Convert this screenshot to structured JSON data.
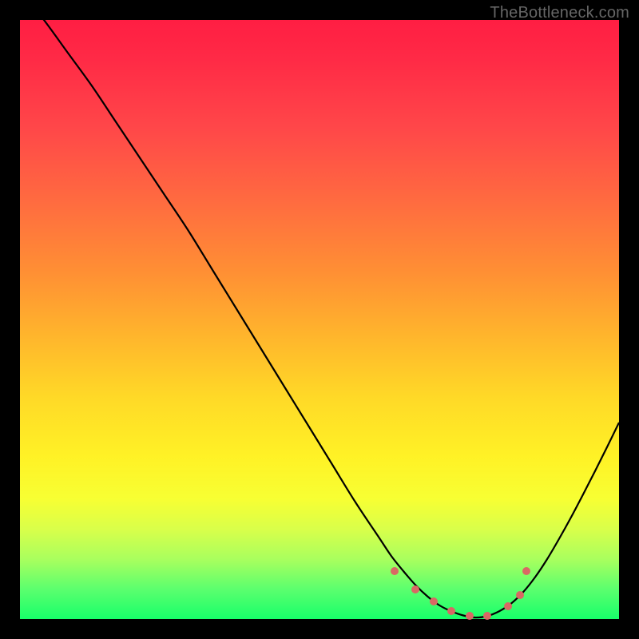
{
  "watermark": "TheBottleneck.com",
  "colors": {
    "curve": "#000000",
    "marker": "#d96864",
    "background": "#000000"
  },
  "chart_data": {
    "type": "line",
    "title": "",
    "xlabel": "",
    "ylabel": "",
    "xlim": [
      0,
      100
    ],
    "ylim": [
      0,
      100
    ],
    "grid": false,
    "series": [
      {
        "name": "bottleneck-curve",
        "x": [
          0,
          4,
          8,
          12,
          16,
          20,
          24,
          28,
          32,
          36,
          40,
          44,
          48,
          52,
          56,
          60,
          62,
          64,
          66,
          68,
          70,
          72,
          74,
          76,
          78,
          80,
          82,
          84,
          86,
          88,
          90,
          92,
          94,
          96,
          98,
          100
        ],
        "values": [
          105,
          100,
          94.5,
          89,
          83,
          77,
          71,
          65,
          58.5,
          52,
          45.5,
          39,
          32.5,
          26,
          19.5,
          13.5,
          10.5,
          8,
          5.7,
          3.8,
          2.3,
          1.3,
          0.6,
          0.25,
          0.5,
          1.3,
          2.6,
          4.5,
          7,
          10,
          13.4,
          17,
          20.8,
          24.7,
          28.7,
          32.8
        ]
      }
    ],
    "markers": [
      {
        "x": 62.5,
        "y": 8.0
      },
      {
        "x": 66.0,
        "y": 5.0
      },
      {
        "x": 69.0,
        "y": 3.0
      },
      {
        "x": 72.0,
        "y": 1.3
      },
      {
        "x": 75.0,
        "y": 0.5
      },
      {
        "x": 78.0,
        "y": 0.6
      },
      {
        "x": 81.5,
        "y": 2.2
      },
      {
        "x": 83.5,
        "y": 4.0
      },
      {
        "x": 84.5,
        "y": 8.0
      }
    ],
    "gradient_stops": [
      {
        "pos": 0,
        "color": "#ff1e43"
      },
      {
        "pos": 50,
        "color": "#ffc927"
      },
      {
        "pos": 80,
        "color": "#f0ff30"
      },
      {
        "pos": 100,
        "color": "#18ff6a"
      }
    ]
  }
}
